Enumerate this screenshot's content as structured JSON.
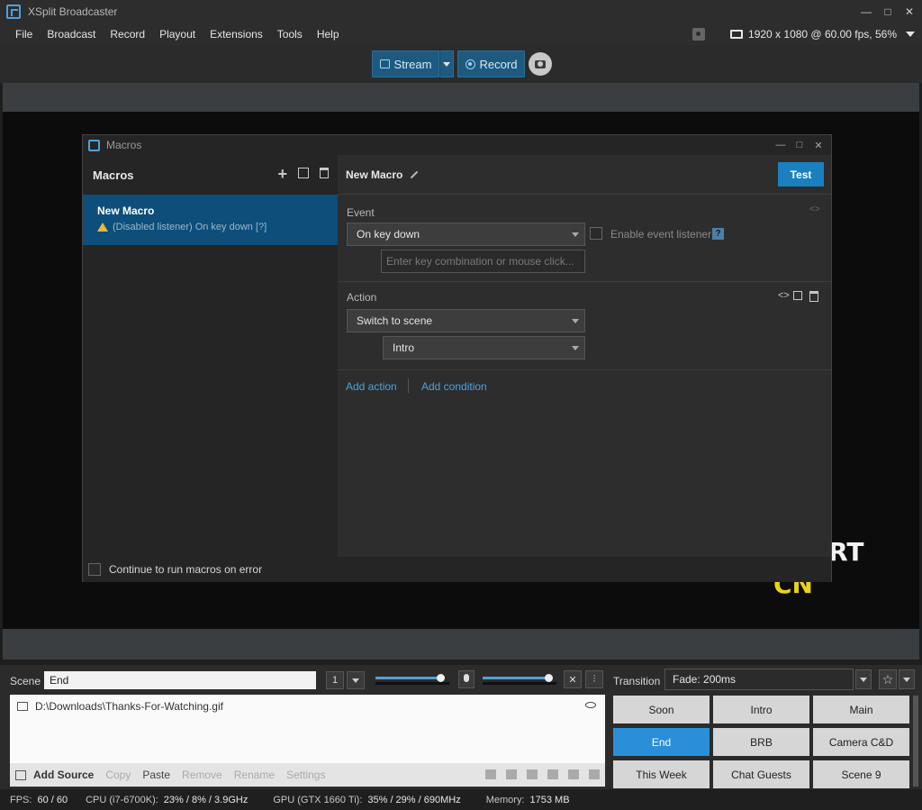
{
  "window": {
    "title": "XSplit Broadcaster"
  },
  "menu": [
    "File",
    "Broadcast",
    "Record",
    "Playout",
    "Extensions",
    "Tools",
    "Help"
  ],
  "resolution": "1920 x 1080 @ 60.00 fps, 56%",
  "toolbar": {
    "stream_label": "Stream",
    "record_label": "Record"
  },
  "macros_dialog": {
    "title": "Macros",
    "list_header": "Macros",
    "macro_name": "New Macro",
    "macro_status": "(Disabled listener) On key down [?]",
    "detail_title": "New Macro",
    "test_label": "Test",
    "event_label": "Event",
    "event_value": "On key down",
    "enable_listener_label": "Enable event listener",
    "help_symbol": "?",
    "key_placeholder": "Enter key combination or mouse click...",
    "action_label": "Action",
    "action_value": "Switch to scene",
    "scene_value": "Intro",
    "add_action": "Add action",
    "add_condition": "Add condition",
    "continue_label": "Continue to run macros on error"
  },
  "bottom": {
    "scene_label": "Scene",
    "scene_name": "End",
    "scene_number": "1",
    "source_path": "D:\\Downloads\\Thanks-For-Watching.gif",
    "add_source": "Add Source",
    "actions": [
      "Copy",
      "Paste",
      "Remove",
      "Rename",
      "Settings"
    ],
    "transition_label": "Transition",
    "transition_value": "Fade: 200ms",
    "scenes": [
      "Soon",
      "Intro",
      "Main",
      "End",
      "BRB",
      "Camera C&D",
      "This Week",
      "Chat Guests",
      "Scene 9"
    ],
    "active_scene": "End",
    "mic_volume": 0.84,
    "speaker_volume": 0.86
  },
  "status": {
    "fps_label": "FPS:",
    "fps_value": "60 / 60",
    "cpu_label": "CPU (i7-6700K):",
    "cpu_value": "23% / 8% / 3.9GHz",
    "gpu_label": "GPU (GTX 1660 Ti):",
    "gpu_value": "35% / 29% / 690MHz",
    "mem_label": "Memory:",
    "mem_value": "1753 MB"
  },
  "colors": {
    "accent": "#1a80c0",
    "selected": "#0e4e7a",
    "link": "#4aa3df"
  },
  "icons": [
    "app-icon",
    "share-icon",
    "monitor-icon",
    "camera-icon",
    "plus-icon",
    "edit-icon",
    "trash-icon",
    "warning-icon",
    "pencil-icon",
    "mic-icon",
    "mute-icon",
    "mixer-icon",
    "eye-icon",
    "star-icon"
  ]
}
